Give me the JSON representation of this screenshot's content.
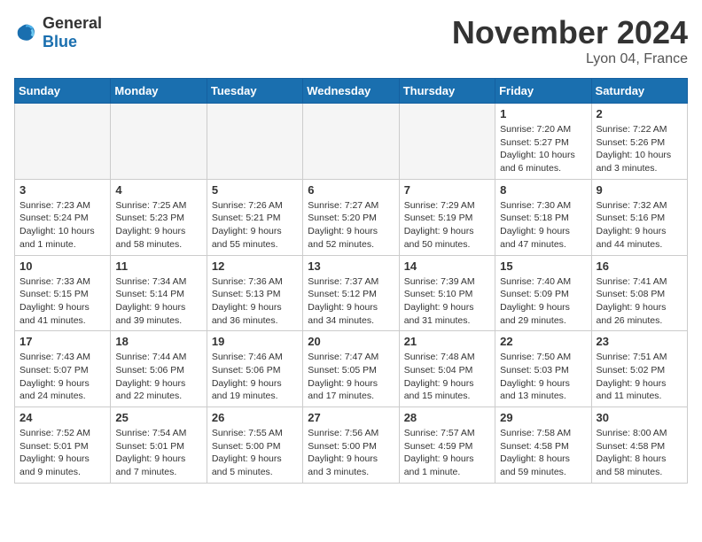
{
  "header": {
    "logo_general": "General",
    "logo_blue": "Blue",
    "month_title": "November 2024",
    "location": "Lyon 04, France"
  },
  "weekdays": [
    "Sunday",
    "Monday",
    "Tuesday",
    "Wednesday",
    "Thursday",
    "Friday",
    "Saturday"
  ],
  "weeks": [
    [
      {
        "day": "",
        "empty": true
      },
      {
        "day": "",
        "empty": true
      },
      {
        "day": "",
        "empty": true
      },
      {
        "day": "",
        "empty": true
      },
      {
        "day": "",
        "empty": true
      },
      {
        "day": "1",
        "sunrise": "7:20 AM",
        "sunset": "5:27 PM",
        "daylight": "10 hours and 6 minutes."
      },
      {
        "day": "2",
        "sunrise": "7:22 AM",
        "sunset": "5:26 PM",
        "daylight": "10 hours and 3 minutes."
      }
    ],
    [
      {
        "day": "3",
        "sunrise": "7:23 AM",
        "sunset": "5:24 PM",
        "daylight": "10 hours and 1 minute."
      },
      {
        "day": "4",
        "sunrise": "7:25 AM",
        "sunset": "5:23 PM",
        "daylight": "9 hours and 58 minutes."
      },
      {
        "day": "5",
        "sunrise": "7:26 AM",
        "sunset": "5:21 PM",
        "daylight": "9 hours and 55 minutes."
      },
      {
        "day": "6",
        "sunrise": "7:27 AM",
        "sunset": "5:20 PM",
        "daylight": "9 hours and 52 minutes."
      },
      {
        "day": "7",
        "sunrise": "7:29 AM",
        "sunset": "5:19 PM",
        "daylight": "9 hours and 50 minutes."
      },
      {
        "day": "8",
        "sunrise": "7:30 AM",
        "sunset": "5:18 PM",
        "daylight": "9 hours and 47 minutes."
      },
      {
        "day": "9",
        "sunrise": "7:32 AM",
        "sunset": "5:16 PM",
        "daylight": "9 hours and 44 minutes."
      }
    ],
    [
      {
        "day": "10",
        "sunrise": "7:33 AM",
        "sunset": "5:15 PM",
        "daylight": "9 hours and 41 minutes."
      },
      {
        "day": "11",
        "sunrise": "7:34 AM",
        "sunset": "5:14 PM",
        "daylight": "9 hours and 39 minutes."
      },
      {
        "day": "12",
        "sunrise": "7:36 AM",
        "sunset": "5:13 PM",
        "daylight": "9 hours and 36 minutes."
      },
      {
        "day": "13",
        "sunrise": "7:37 AM",
        "sunset": "5:12 PM",
        "daylight": "9 hours and 34 minutes."
      },
      {
        "day": "14",
        "sunrise": "7:39 AM",
        "sunset": "5:10 PM",
        "daylight": "9 hours and 31 minutes."
      },
      {
        "day": "15",
        "sunrise": "7:40 AM",
        "sunset": "5:09 PM",
        "daylight": "9 hours and 29 minutes."
      },
      {
        "day": "16",
        "sunrise": "7:41 AM",
        "sunset": "5:08 PM",
        "daylight": "9 hours and 26 minutes."
      }
    ],
    [
      {
        "day": "17",
        "sunrise": "7:43 AM",
        "sunset": "5:07 PM",
        "daylight": "9 hours and 24 minutes."
      },
      {
        "day": "18",
        "sunrise": "7:44 AM",
        "sunset": "5:06 PM",
        "daylight": "9 hours and 22 minutes."
      },
      {
        "day": "19",
        "sunrise": "7:46 AM",
        "sunset": "5:06 PM",
        "daylight": "9 hours and 19 minutes."
      },
      {
        "day": "20",
        "sunrise": "7:47 AM",
        "sunset": "5:05 PM",
        "daylight": "9 hours and 17 minutes."
      },
      {
        "day": "21",
        "sunrise": "7:48 AM",
        "sunset": "5:04 PM",
        "daylight": "9 hours and 15 minutes."
      },
      {
        "day": "22",
        "sunrise": "7:50 AM",
        "sunset": "5:03 PM",
        "daylight": "9 hours and 13 minutes."
      },
      {
        "day": "23",
        "sunrise": "7:51 AM",
        "sunset": "5:02 PM",
        "daylight": "9 hours and 11 minutes."
      }
    ],
    [
      {
        "day": "24",
        "sunrise": "7:52 AM",
        "sunset": "5:01 PM",
        "daylight": "9 hours and 9 minutes."
      },
      {
        "day": "25",
        "sunrise": "7:54 AM",
        "sunset": "5:01 PM",
        "daylight": "9 hours and 7 minutes."
      },
      {
        "day": "26",
        "sunrise": "7:55 AM",
        "sunset": "5:00 PM",
        "daylight": "9 hours and 5 minutes."
      },
      {
        "day": "27",
        "sunrise": "7:56 AM",
        "sunset": "5:00 PM",
        "daylight": "9 hours and 3 minutes."
      },
      {
        "day": "28",
        "sunrise": "7:57 AM",
        "sunset": "4:59 PM",
        "daylight": "9 hours and 1 minute."
      },
      {
        "day": "29",
        "sunrise": "7:58 AM",
        "sunset": "4:58 PM",
        "daylight": "8 hours and 59 minutes."
      },
      {
        "day": "30",
        "sunrise": "8:00 AM",
        "sunset": "4:58 PM",
        "daylight": "8 hours and 58 minutes."
      }
    ]
  ],
  "labels": {
    "sunrise": "Sunrise:",
    "sunset": "Sunset:",
    "daylight": "Daylight:"
  }
}
